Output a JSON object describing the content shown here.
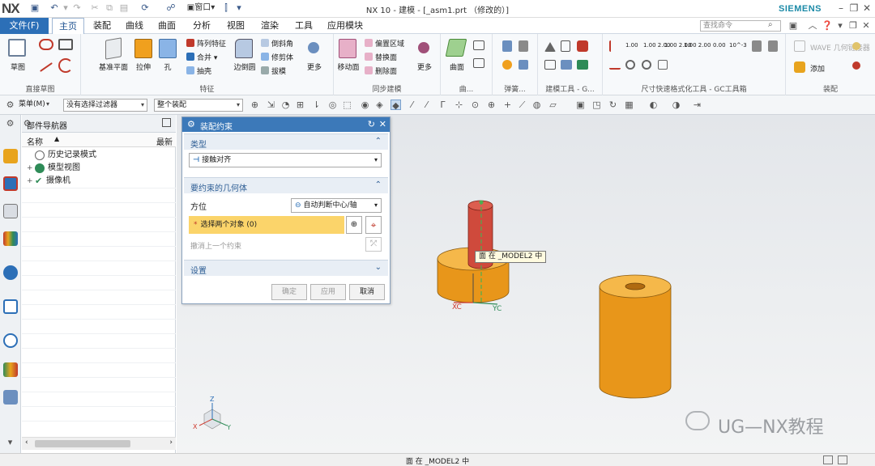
{
  "app": {
    "logo": "NX",
    "window_title": "NX 10 - 建模 - [_asm1.prt （修改的）]",
    "brand": "SIEMENS"
  },
  "menu": {
    "file": "文件(F)",
    "tabs": [
      "主页",
      "装配",
      "曲线",
      "曲面",
      "分析",
      "视图",
      "渲染",
      "工具",
      "应用模块"
    ],
    "active_tab": "主页",
    "search_placeholder": "查找命令"
  },
  "ribbon": {
    "groups": {
      "direct_sketch": "直接草图",
      "feature": "特征",
      "sync_modeling": "同步建模",
      "surface": "曲...",
      "spring": "弹簧...",
      "model_tool": "建模工具 - G...",
      "dim_tool": "尺寸快速格式化工具 - GC工具箱",
      "assembly": "装配"
    },
    "buttons": {
      "sketch": "草图",
      "datum_plane": "基准平面",
      "extrude": "拉伸",
      "hole": "孔",
      "array_feature": "阵列特征",
      "unite": "合并",
      "shell": "抽壳",
      "edge_blend": "边倒圆",
      "chamfer": "倒斜角",
      "trim_body": "修剪体",
      "draft": "拔模",
      "more_feature": "更多",
      "move_face": "移动面",
      "offset_region": "偏置区域",
      "replace_face": "替换面",
      "delete_face": "删除面",
      "more_sync": "更多",
      "surface": "曲面",
      "add": "添加",
      "wave_link": "WAVE 几何链接器"
    },
    "dim_icons": [
      "1.00",
      "1.00\n2.00",
      "1.00\n2.00",
      "1.00\n2.00",
      "0.00",
      "10^-3"
    ]
  },
  "selbar": {
    "menu": "菜单(M)",
    "filter": "没有选择过滤器",
    "scope": "整个装配"
  },
  "navigator": {
    "title": "部件导航器",
    "col_name": "名称",
    "col_latest": "最新",
    "rows": [
      {
        "label": "历史记录模式",
        "icon_color": "#8a8a8a"
      },
      {
        "label": "模型视图",
        "icon_color": "#2e8b57"
      },
      {
        "label": "摄像机",
        "icon_color": "#c0392b"
      }
    ]
  },
  "dialog": {
    "title": "装配约束",
    "section_type": "类型",
    "type_value": "接触对齐",
    "section_geometry": "要约束的几何体",
    "orientation_label": "方位",
    "orientation_value": "自动判断中心/轴",
    "select_objects": "选择两个对象 (0)",
    "undo_last": "撤消上一个约束",
    "section_settings": "设置",
    "ok": "确定",
    "apply": "应用",
    "cancel": "取消"
  },
  "viewport": {
    "tooltip": "面 在 _MODEL2 中",
    "axis_xc": "XC",
    "axis_yc": "YC",
    "triad_x": "X",
    "triad_y": "Y",
    "triad_z": "Z"
  },
  "watermark": "UG—NX教程",
  "status": "面 在 _MODEL2 中",
  "colors": {
    "accent": "#2c6fb7",
    "dialog_header": "#3c79b9",
    "cylinder": "#f0a01e",
    "highlight_cylinder": "#d9473a",
    "selection_yellow": "#fbd46a"
  }
}
